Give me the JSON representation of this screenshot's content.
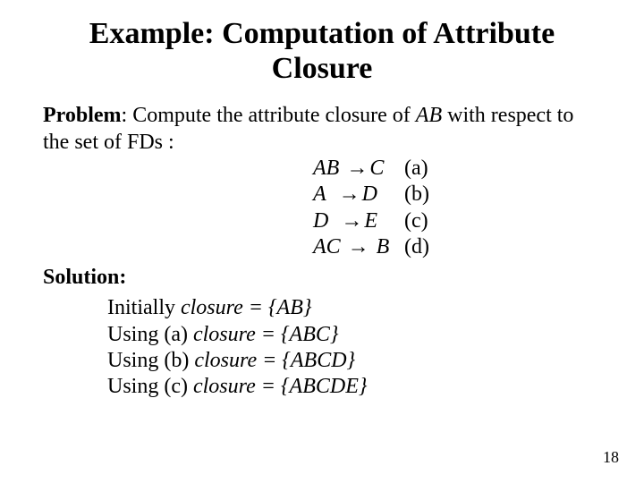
{
  "title": "Example: Computation of Attribute Closure",
  "problem": {
    "label": "Problem",
    "text_before_ab": ": Compute the attribute closure of ",
    "ab": "AB",
    "text_after_ab": " with respect to the set of FDs :"
  },
  "fds": [
    {
      "lhs": "AB",
      "rhs": "C",
      "tag": "(a)"
    },
    {
      "lhs": "A",
      "rhs": "D",
      "tag": "(b)"
    },
    {
      "lhs": "D",
      "rhs": "E",
      "tag": "(c)"
    },
    {
      "lhs": "AC",
      "rhs": "B",
      "tag": "(d)"
    }
  ],
  "arrow": "→",
  "solution_label": "Solution",
  "solution_colon": ":",
  "steps": [
    {
      "prefix": "Initially ",
      "var": "closure",
      "rest": " = {AB}"
    },
    {
      "prefix": "Using (a) ",
      "var": "closure",
      "rest": " = {ABC}"
    },
    {
      "prefix": "Using (b) ",
      "var": "closure",
      "rest": " = {ABCD}"
    },
    {
      "prefix": "Using (c) ",
      "var": "closure",
      "rest": " = {ABCDE}"
    }
  ],
  "page_number": "18"
}
